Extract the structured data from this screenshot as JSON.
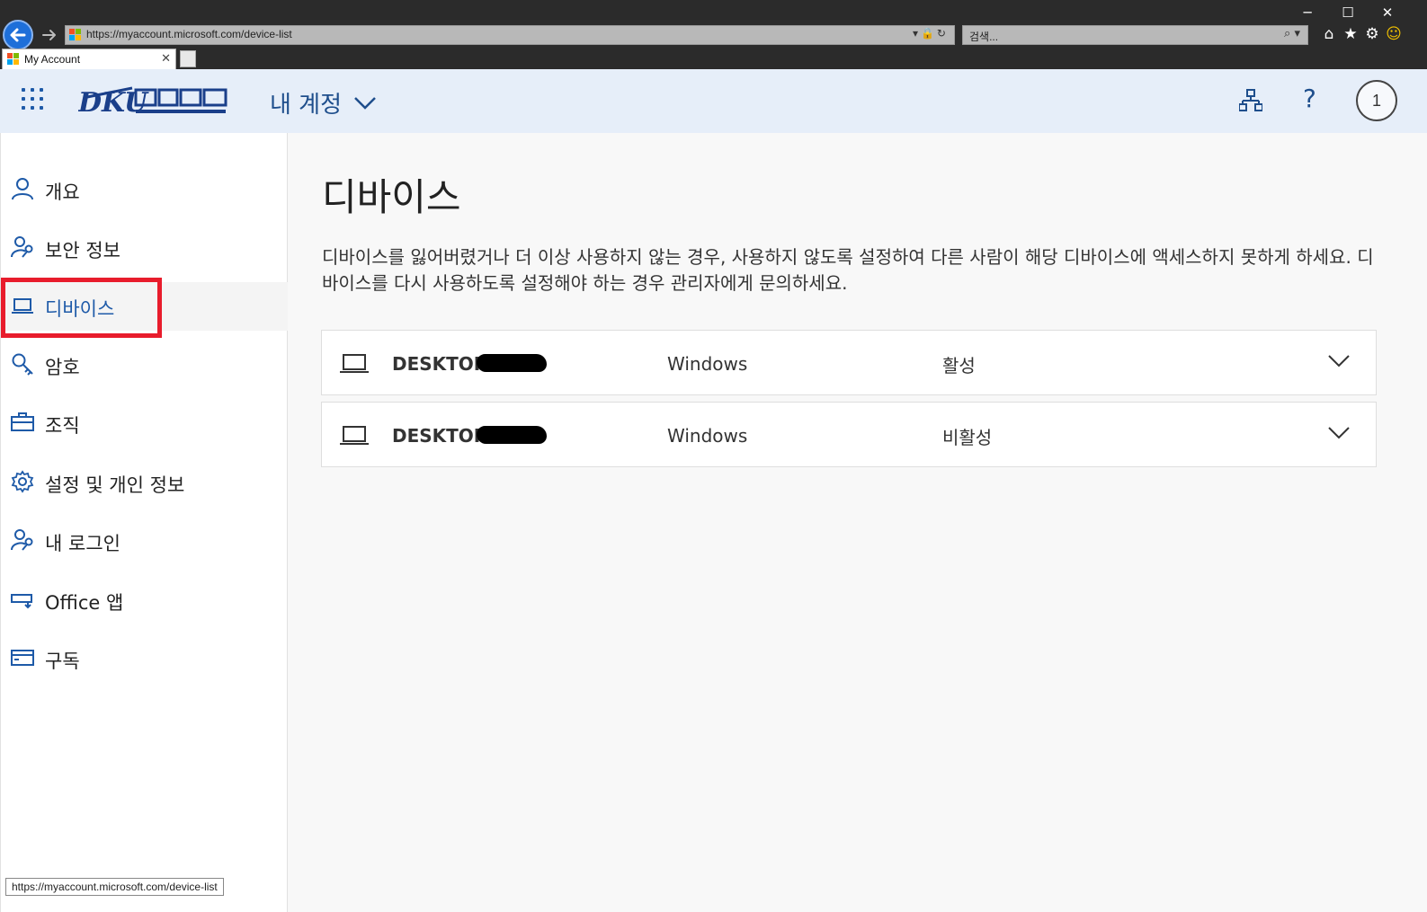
{
  "browser": {
    "window_controls": {
      "minimize": "─",
      "maximize": "☐",
      "close": "✕"
    },
    "address": "https://myaccount.microsoft.com/device-list",
    "search_placeholder": "검색...",
    "tab_title": "My Account",
    "status_url": "https://myaccount.microsoft.com/device-list"
  },
  "header": {
    "account_title": "내 계정",
    "avatar_initial": "1",
    "help_label": "?",
    "colors": {
      "header_bg": "#e6eef9",
      "brand": "#1e4e8c"
    }
  },
  "sidebar": {
    "items": [
      {
        "label": "개요",
        "icon": "person-icon"
      },
      {
        "label": "보안 정보",
        "icon": "person-key-icon"
      },
      {
        "label": "디바이스",
        "icon": "laptop-icon",
        "active": true
      },
      {
        "label": "암호",
        "icon": "key-icon"
      },
      {
        "label": "조직",
        "icon": "briefcase-icon"
      },
      {
        "label": "설정 및 개인 정보",
        "icon": "gear-icon"
      },
      {
        "label": "내 로그인",
        "icon": "person-key-icon"
      },
      {
        "label": "Office 앱",
        "icon": "office-apps-icon"
      },
      {
        "label": "구독",
        "icon": "card-icon"
      }
    ],
    "highlight_color": "#e81c2c"
  },
  "main": {
    "title": "디바이스",
    "description": "디바이스를 잃어버렸거나 더 이상 사용하지 않는 경우, 사용하지 않도록 설정하여 다른 사람이 해당 디바이스에 액세스하지 못하게 하세요. 디바이스를 다시 사용하도록 설정해야 하는 경우 관리자에게 문의하세요.",
    "devices": [
      {
        "name": "DESKTOP-",
        "os": "Windows",
        "status": "활성"
      },
      {
        "name": "DESKTOP-",
        "os": "Windows",
        "status": "비활성"
      }
    ]
  }
}
